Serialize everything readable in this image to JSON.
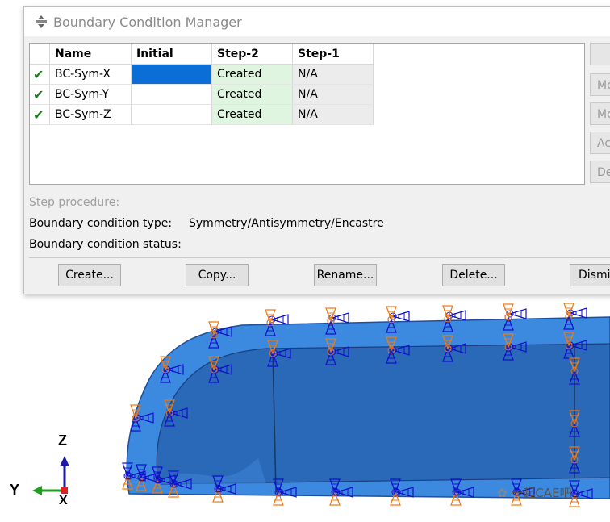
{
  "dialog": {
    "title": "Boundary Condition Manager",
    "columns": [
      "",
      "Name",
      "Initial",
      "Step-2",
      "Step-1"
    ],
    "rows": [
      {
        "name": "BC-Sym-X",
        "initial": "",
        "step2": "Created",
        "step1": "N/A",
        "active": true,
        "selected": true
      },
      {
        "name": "BC-Sym-Y",
        "initial": "",
        "step2": "Created",
        "step1": "N/A",
        "active": true,
        "selected": false
      },
      {
        "name": "BC-Sym-Z",
        "initial": "",
        "step2": "Created",
        "step1": "N/A",
        "active": true,
        "selected": false
      }
    ],
    "side_buttons": [
      "",
      "Mo",
      "Mo",
      "Ac",
      "De"
    ],
    "info": {
      "step_procedure_label": "Step procedure:",
      "bc_type_label": "Boundary condition type:",
      "bc_type_value": "Symmetry/Antisymmetry/Encastre",
      "bc_status_label": "Boundary condition status:"
    },
    "buttons": {
      "create": "Create...",
      "copy": "Copy...",
      "rename": "Rename...",
      "delete": "Delete...",
      "dismiss": "Dismi"
    }
  },
  "viewport": {
    "triad": {
      "z": "Z",
      "y": "Y",
      "x": "X"
    },
    "colors": {
      "part": "#3c8ae0",
      "part_dark": "#2561ad",
      "bc_blue": "#1010d0",
      "bc_orange": "#f07a10"
    }
  },
  "watermark": "一起CAE吧"
}
